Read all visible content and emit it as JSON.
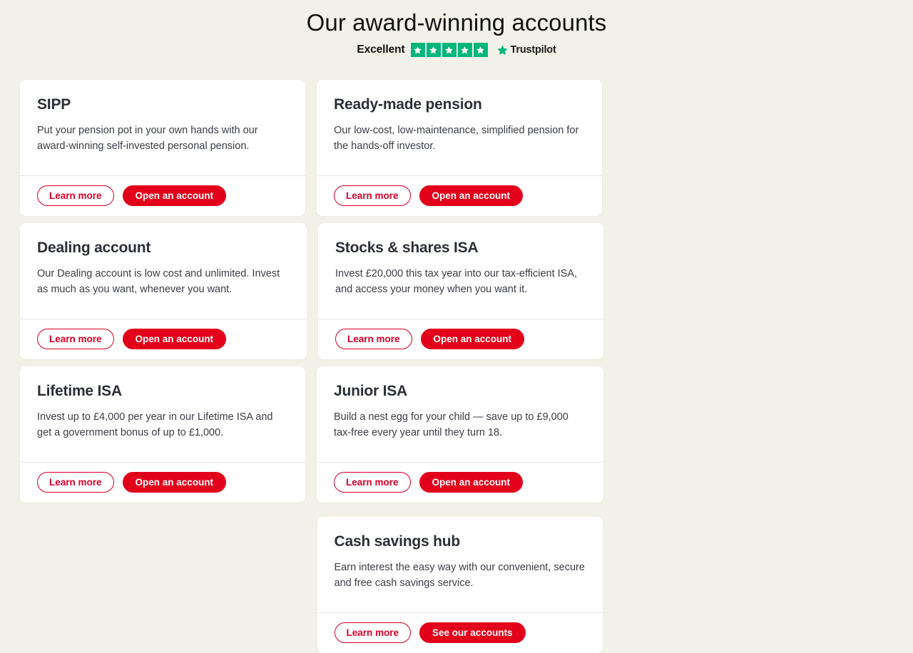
{
  "header": {
    "title": "Our award-winning accounts",
    "trustpilot": {
      "rating_word": "Excellent",
      "stars": 5,
      "brand": "Trustpilot",
      "star_color": "#00b67a"
    }
  },
  "theme": {
    "background": "#f1f1e9",
    "card_background": "#ffffff",
    "primary_red": "#e2001a",
    "outline_red": "#d80027",
    "title_color": "#2c2f36",
    "body_color": "#3a3d44"
  },
  "cards": [
    {
      "title": "SIPP",
      "description": "Put your pension pot in your own hands with our award-winning self-invested personal pension.",
      "secondary_label": "Learn more",
      "primary_label": "Open an account"
    },
    {
      "title": "Ready-made pension",
      "description": "Our low-cost, low-maintenance, simplified pension for the hands-off investor.",
      "secondary_label": "Learn more",
      "primary_label": "Open an account"
    },
    {
      "title": "Dealing account",
      "description": "Our Dealing account is low cost and unlimited. Invest as much as you want, whenever you want.",
      "secondary_label": "Learn more",
      "primary_label": "Open an account"
    },
    {
      "title": "Stocks & shares ISA",
      "description": "Invest £20,000 this tax year into our tax-efficient ISA, and access your money when you want it.",
      "secondary_label": "Learn more",
      "primary_label": "Open an account"
    },
    {
      "title": "Lifetime ISA",
      "description": "Invest up to £4,000 per year in our Lifetime ISA and get a government bonus of up to £1,000.",
      "secondary_label": "Learn more",
      "primary_label": "Open an account"
    },
    {
      "title": "Junior ISA",
      "description": "Build a nest egg for your child — save up to £9,000 tax-free every year until they turn 18.",
      "secondary_label": "Learn more",
      "primary_label": "Open an account"
    },
    {
      "title": "Cash savings hub",
      "description": "Earn interest the easy way with our convenient, secure and free cash savings service.",
      "secondary_label": "Learn more",
      "primary_label": "See our accounts"
    }
  ]
}
